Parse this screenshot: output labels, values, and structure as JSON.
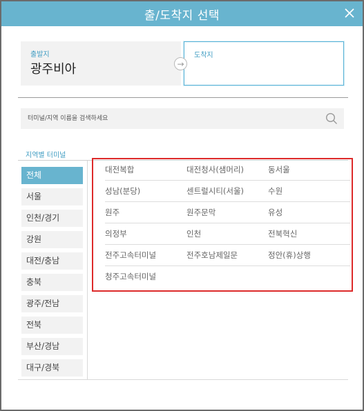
{
  "dialog": {
    "title": "출/도착지 선택",
    "close_icon": "close-icon"
  },
  "departure": {
    "label": "출발지",
    "value": "광주비아"
  },
  "arrival": {
    "label": "도착지",
    "value": ""
  },
  "swap": {
    "icon": "swap-icon",
    "glyph": "→"
  },
  "search": {
    "placeholder": "터미널/지역 이름을 검색하세요",
    "icon": "search-icon"
  },
  "regions": {
    "title": "지역별 터미널",
    "items": [
      {
        "label": "전체",
        "active": true
      },
      {
        "label": "서울"
      },
      {
        "label": "인천/경기"
      },
      {
        "label": "강원"
      },
      {
        "label": "대전/충남"
      },
      {
        "label": "충북"
      },
      {
        "label": "광주/전남"
      },
      {
        "label": "전북"
      },
      {
        "label": "부산/경남"
      },
      {
        "label": "대구/경북"
      }
    ]
  },
  "terminals": [
    "대전복합",
    "대전청사(샘머리)",
    "동서울",
    "성남(분당)",
    "센트럴시티(서울)",
    "수원",
    "원주",
    "원주문막",
    "유성",
    "의정부",
    "인천",
    "전북혁신",
    "전주고속터미널",
    "전주호남제일문",
    "정안(휴)상행",
    "청주고속터미널"
  ],
  "colors": {
    "header": "#68b4cf",
    "accent": "#3f9cc2",
    "highlight_border": "#dd2a2a"
  }
}
